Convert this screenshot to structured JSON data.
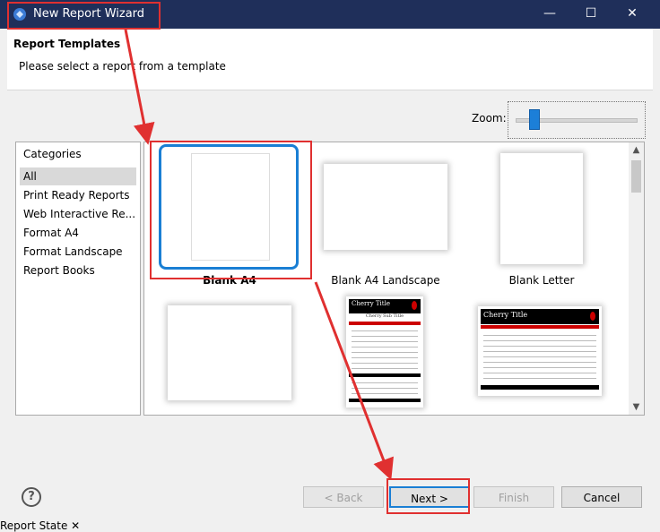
{
  "window": {
    "title": "New Report Wizard",
    "minimize_label": "—",
    "maximize_label": "☐",
    "close_label": "✕"
  },
  "header": {
    "title": "Report Templates",
    "subtitle": "Please select a report from a template"
  },
  "zoom": {
    "label": "Zoom:",
    "level_fraction": 0.12
  },
  "categories": {
    "header": "Categories",
    "items": [
      "All",
      "Print Ready Reports",
      "Web Interactive Re...",
      "Format A4",
      "Format Landscape",
      "Report Books"
    ],
    "selected_index": 0
  },
  "templates": {
    "items": [
      {
        "label": "Blank A4"
      },
      {
        "label": "Blank A4 Landscape"
      },
      {
        "label": "Blank Letter"
      },
      {
        "label": ""
      },
      {
        "label": ""
      },
      {
        "label": ""
      }
    ],
    "cherry_title": "Cherry Title",
    "cherry_subtitle": "Cherry Sub Title"
  },
  "buttons": {
    "help": "?",
    "back": "< Back",
    "next": "Next >",
    "finish": "Finish",
    "cancel": "Cancel"
  },
  "bottom_tab": {
    "label": "Report State ✕"
  },
  "colors": {
    "titlebar": "#1f2f5a",
    "selection": "#1a7fd4",
    "annotation": "#e03030"
  }
}
